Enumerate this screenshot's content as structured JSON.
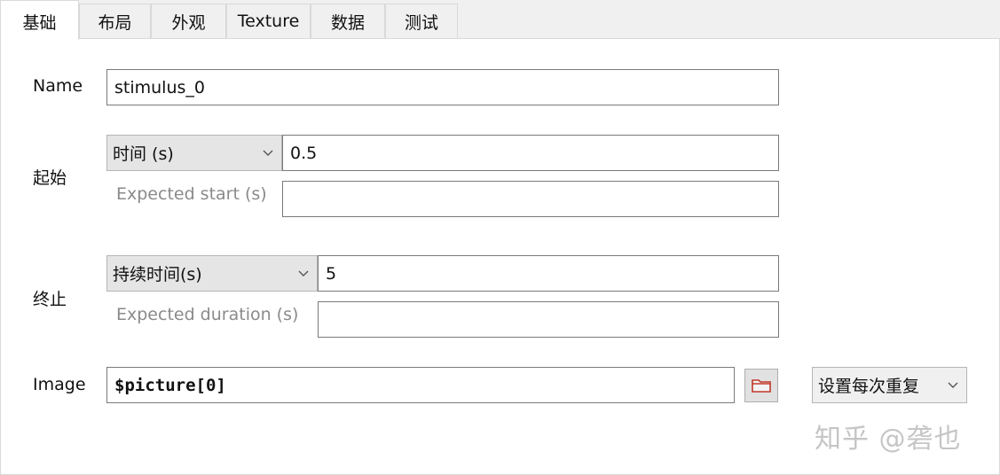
{
  "tabs": [
    {
      "label": "基础"
    },
    {
      "label": "布局"
    },
    {
      "label": "外观"
    },
    {
      "label": "Texture"
    },
    {
      "label": "数据"
    },
    {
      "label": "测试"
    }
  ],
  "name_row": {
    "label": "Name",
    "value": "stimulus_0"
  },
  "start": {
    "label": "起始",
    "type_selected": "时间 (s)",
    "value": "0.5",
    "expected_label": "Expected start (s)",
    "expected_value": ""
  },
  "stop": {
    "label": "终止",
    "type_selected": "持续时间(s)",
    "value": "5",
    "expected_label": "Expected duration (s)",
    "expected_value": ""
  },
  "image_row": {
    "label": "Image",
    "value": "$picture[0]",
    "repeat_selected": "设置每次重复"
  },
  "watermark": "知乎 @砻也",
  "icons": {
    "browse": "folder-icon",
    "dropdown": "chevron-down-icon"
  },
  "colors": {
    "folder_icon": "#c0392b",
    "combo_bg": "#e5e5e5"
  }
}
